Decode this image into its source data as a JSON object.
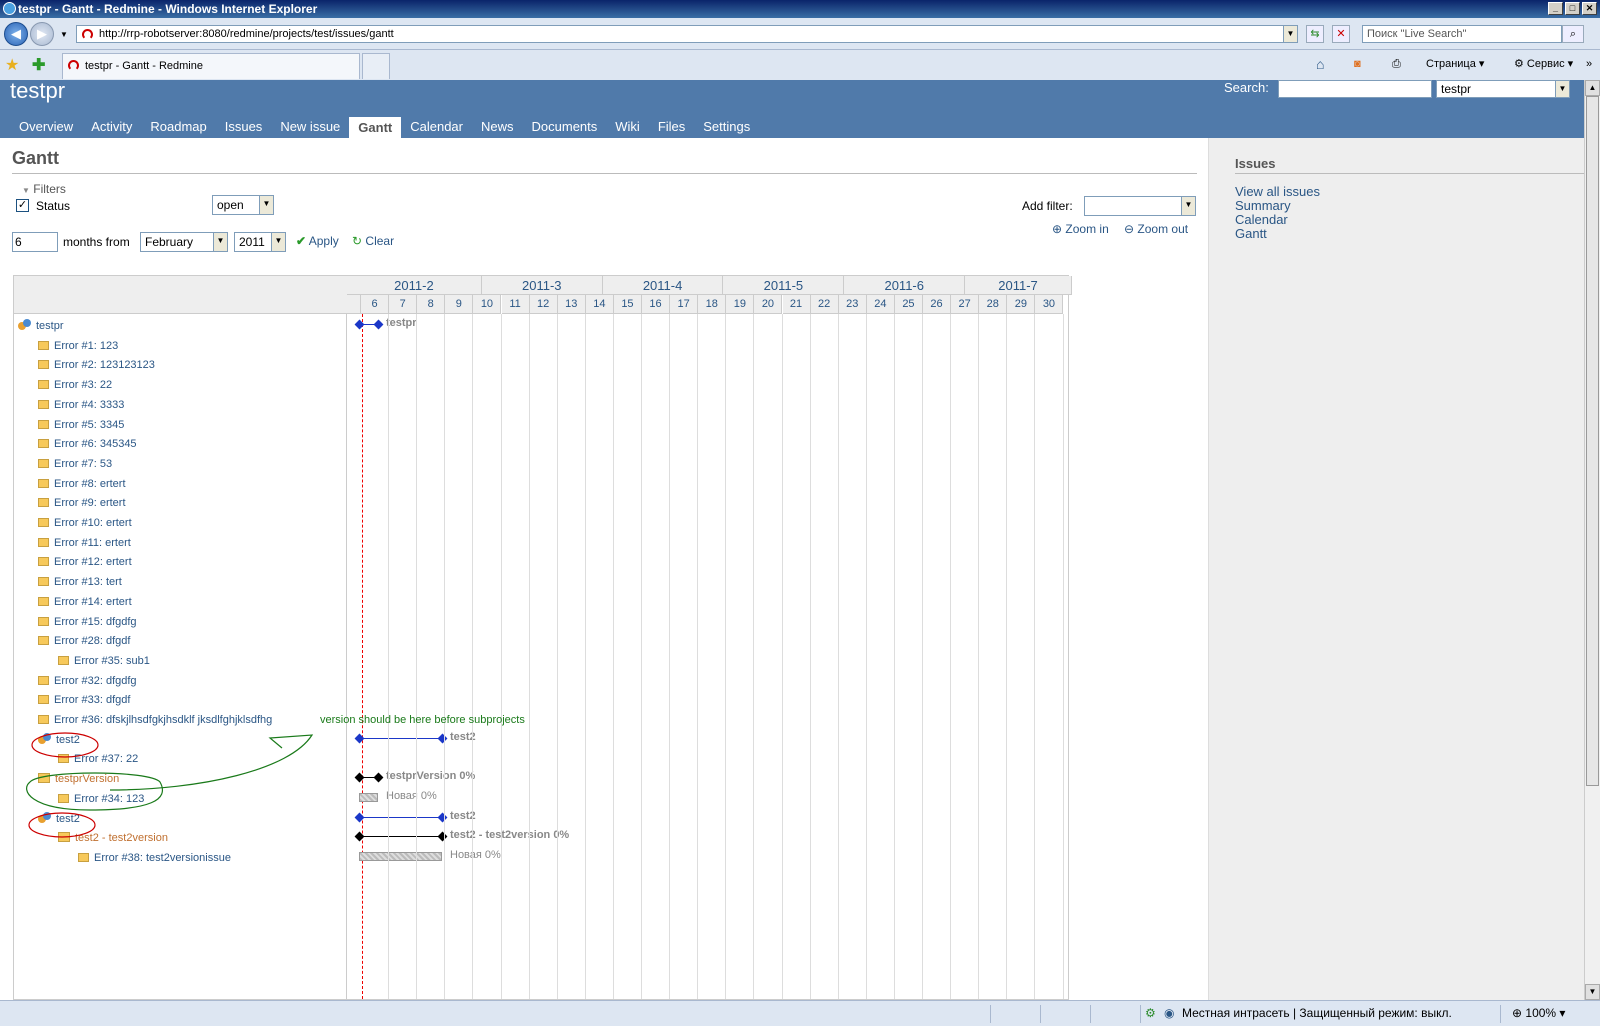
{
  "window": {
    "title": "testpr - Gantt - Redmine - Windows Internet Explorer"
  },
  "browser": {
    "url": "http://rrp-robotserver:8080/redmine/projects/test/issues/gantt",
    "search_placeholder": "Поиск \"Live Search\"",
    "tab_title": "testpr - Gantt - Redmine",
    "toolbar": {
      "page": "Страница",
      "service": "Сервис"
    },
    "status_zone": "Местная интрасеть | Защищенный режим: выкл.",
    "zoom": "100%"
  },
  "header": {
    "project": "testpr",
    "search_label": "Search:",
    "project_jump": "testpr"
  },
  "menu": [
    "Overview",
    "Activity",
    "Roadmap",
    "Issues",
    "New issue",
    "Gantt",
    "Calendar",
    "News",
    "Documents",
    "Wiki",
    "Files",
    "Settings"
  ],
  "menu_selected": "Gantt",
  "page": {
    "title": "Gantt",
    "filters_label": "Filters",
    "status_label": "Status",
    "status_value": "open",
    "add_filter_label": "Add filter:",
    "months": "6",
    "months_from": "months from",
    "month": "February",
    "year": "2011",
    "apply": "Apply",
    "clear": "Clear",
    "zoom_in": "Zoom in",
    "zoom_out": "Zoom out"
  },
  "sidebar": {
    "title": "Issues",
    "links": [
      "View all issues",
      "Summary",
      "Calendar",
      "Gantt"
    ]
  },
  "gantt": {
    "months": [
      "2011-2",
      "2011-3",
      "2011-4",
      "2011-5",
      "2011-6",
      "2011-7"
    ],
    "weeks": [
      "6",
      "7",
      "8",
      "9",
      "10",
      "11",
      "12",
      "13",
      "14",
      "15",
      "16",
      "17",
      "18",
      "19",
      "20",
      "21",
      "22",
      "23",
      "24",
      "25",
      "26",
      "27",
      "28",
      "29",
      "30"
    ],
    "rows": [
      {
        "type": "project",
        "label": "testpr",
        "indent": 0
      },
      {
        "type": "issue",
        "label": "Error #1: 123",
        "indent": 1
      },
      {
        "type": "issue",
        "label": "Error #2: 123123123",
        "indent": 1
      },
      {
        "type": "issue",
        "label": "Error #3: 22",
        "indent": 1
      },
      {
        "type": "issue",
        "label": "Error #4: 3333",
        "indent": 1
      },
      {
        "type": "issue",
        "label": "Error #5: 3345",
        "indent": 1
      },
      {
        "type": "issue",
        "label": "Error #6: 345345",
        "indent": 1
      },
      {
        "type": "issue",
        "label": "Error #7: 53",
        "indent": 1
      },
      {
        "type": "issue",
        "label": "Error #8: ertert",
        "indent": 1
      },
      {
        "type": "issue",
        "label": "Error #9: ertert",
        "indent": 1
      },
      {
        "type": "issue",
        "label": "Error #10: ertert",
        "indent": 1
      },
      {
        "type": "issue",
        "label": "Error #11: ertert",
        "indent": 1
      },
      {
        "type": "issue",
        "label": "Error #12: ertert",
        "indent": 1
      },
      {
        "type": "issue",
        "label": "Error #13: tert",
        "indent": 1
      },
      {
        "type": "issue",
        "label": "Error #14: ertert",
        "indent": 1
      },
      {
        "type": "issue",
        "label": "Error #15: dfgdfg",
        "indent": 1
      },
      {
        "type": "issue",
        "label": "Error #28: dfgdf",
        "indent": 1
      },
      {
        "type": "issue",
        "label": "Error #35: sub1",
        "indent": 2
      },
      {
        "type": "issue",
        "label": "Error #32: dfgdfg",
        "indent": 1
      },
      {
        "type": "issue",
        "label": "Error #33: dfgdf",
        "indent": 1
      },
      {
        "type": "issue",
        "label": "Error #36: dfskjlhsdfgkjhsdklf jksdlfghjklsdfhg",
        "indent": 1
      },
      {
        "type": "project",
        "label": "test2",
        "indent": 1
      },
      {
        "type": "issue",
        "label": "Error #37: 22",
        "indent": 2
      },
      {
        "type": "version",
        "label": "testprVersion",
        "indent": 1
      },
      {
        "type": "issue",
        "label": "Error #34: 123",
        "indent": 2
      },
      {
        "type": "project",
        "label": "test2",
        "indent": 1
      },
      {
        "type": "version",
        "label": "test2 - test2version",
        "indent": 2
      },
      {
        "type": "issue",
        "label": "Error #38: test2versionissue",
        "indent": 3
      }
    ],
    "bars": {
      "testpr": "testpr",
      "test2_a": "test2",
      "testprVersion": "testprVersion 0%",
      "issue34": "Новая 0%",
      "test2_b": "test2",
      "test2version": "test2 - test2version 0%",
      "issue38": "Новая 0%"
    },
    "annotation": "version should be here before subprojects"
  }
}
